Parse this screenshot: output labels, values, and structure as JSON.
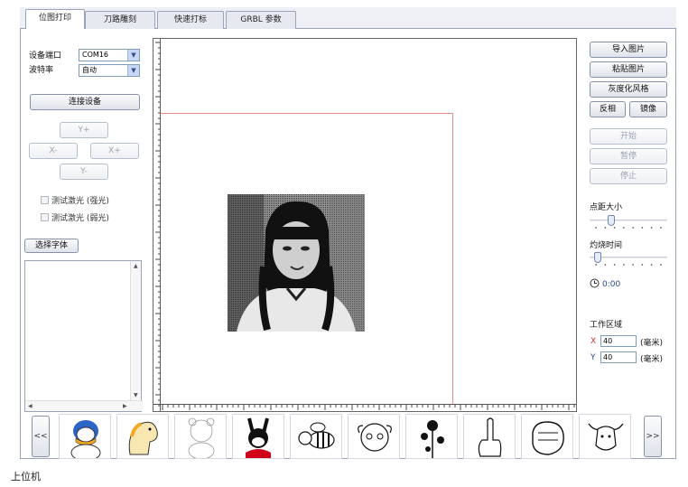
{
  "tabs": [
    "位图打印",
    "刀路雕刻",
    "快速打标",
    "GRBL 参数"
  ],
  "left": {
    "port_label": "设备端口",
    "port_value": "COM16",
    "baud_label": "波特率",
    "baud_value": "自动",
    "connect_button": "连接设备",
    "jog": {
      "up": "Y+",
      "left": "X-",
      "right": "X+",
      "down": "Y-"
    },
    "test_strong": "测试激光 (强光)",
    "test_weak": "测试激光 (弱光)",
    "font_button": "选择字体"
  },
  "right": {
    "import_image": "导入图片",
    "paste_image": "粘贴图片",
    "grayscale_style": "灰度化风格",
    "invert": "反相",
    "mirror": "镜像",
    "start": "开始",
    "pause": "暂停",
    "stop": "停止",
    "dot_size_label": "点距大小",
    "dot_size_level": 0.25,
    "burn_time_label": "灼烧时间",
    "burn_time_level": 0.07,
    "timer": "0:00",
    "work_area_label": "工作区域",
    "x_label": "X",
    "x_value": "40",
    "y_label": "Y",
    "y_value": "40",
    "unit": "(毫米)"
  },
  "thumbnails": {
    "prev": "<<",
    "next": ">>",
    "items": [
      "duck-thumbnail",
      "horse-thumbnail",
      "bear-thumbnail",
      "rabbit-thumbnail",
      "bee-thumbnail",
      "sheep-thumbnail",
      "flower-thumbnail",
      "finger-thumbnail",
      "fist-thumbnail",
      "bull-thumbnail"
    ]
  },
  "caption": "上位机"
}
